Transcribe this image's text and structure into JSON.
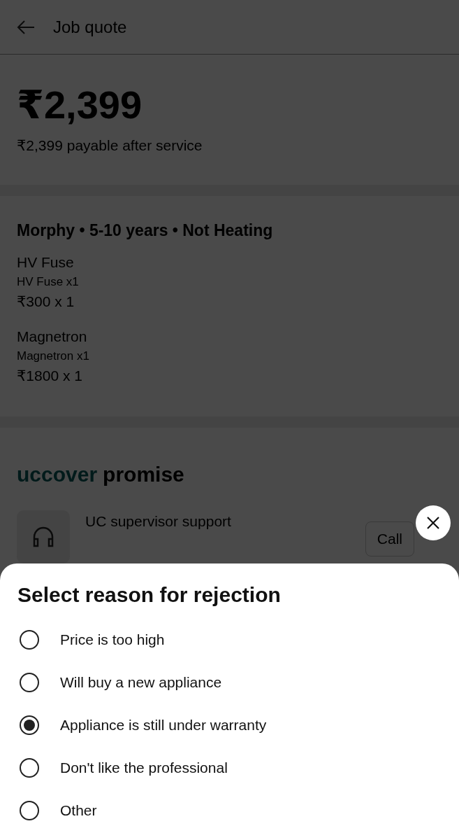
{
  "header": {
    "title": "Job quote"
  },
  "price": {
    "amount": "₹2,399",
    "note": "₹2,399 payable after service"
  },
  "job": {
    "summary": "Morphy • 5-10 years • Not Heating",
    "parts": [
      {
        "name": "HV Fuse",
        "detail": "HV Fuse x1",
        "cost": "₹300 x 1"
      },
      {
        "name": "Magnetron",
        "detail": "Magnetron x1",
        "cost": "₹1800 x 1"
      }
    ]
  },
  "promise": {
    "brand": "uccover",
    "title": "promise",
    "support": {
      "title": "UC supervisor support",
      "action": "Call"
    }
  },
  "sheet": {
    "title": "Select reason for rejection",
    "options": [
      {
        "label": "Price is too high",
        "selected": false
      },
      {
        "label": "Will buy a new appliance",
        "selected": false
      },
      {
        "label": "Appliance is still under warranty",
        "selected": true
      },
      {
        "label": "Don't like the professional",
        "selected": false
      },
      {
        "label": "Other",
        "selected": false
      }
    ]
  }
}
